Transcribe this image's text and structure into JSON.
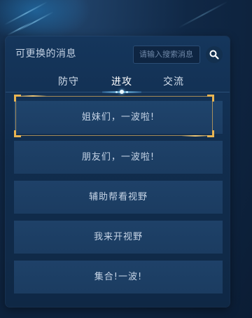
{
  "panel": {
    "title": "可更换的消息",
    "search": {
      "placeholder": "请输入搜索消息",
      "icon": "search-icon"
    }
  },
  "tabs": [
    {
      "label": "防守",
      "active": false
    },
    {
      "label": "进攻",
      "active": true
    },
    {
      "label": "交流",
      "active": false
    }
  ],
  "messages": [
    {
      "text": "姐妹们，一波啦!",
      "selected": true
    },
    {
      "text": "朋友们，一波啦!",
      "selected": false
    },
    {
      "text": "辅助帮看视野",
      "selected": false
    },
    {
      "text": "我来开视野",
      "selected": false
    },
    {
      "text": "集合!一波!",
      "selected": false
    }
  ],
  "colors": {
    "accent_gold": "#e8b452",
    "panel_bg": "#112d4e",
    "item_bg": "#1e4168"
  }
}
